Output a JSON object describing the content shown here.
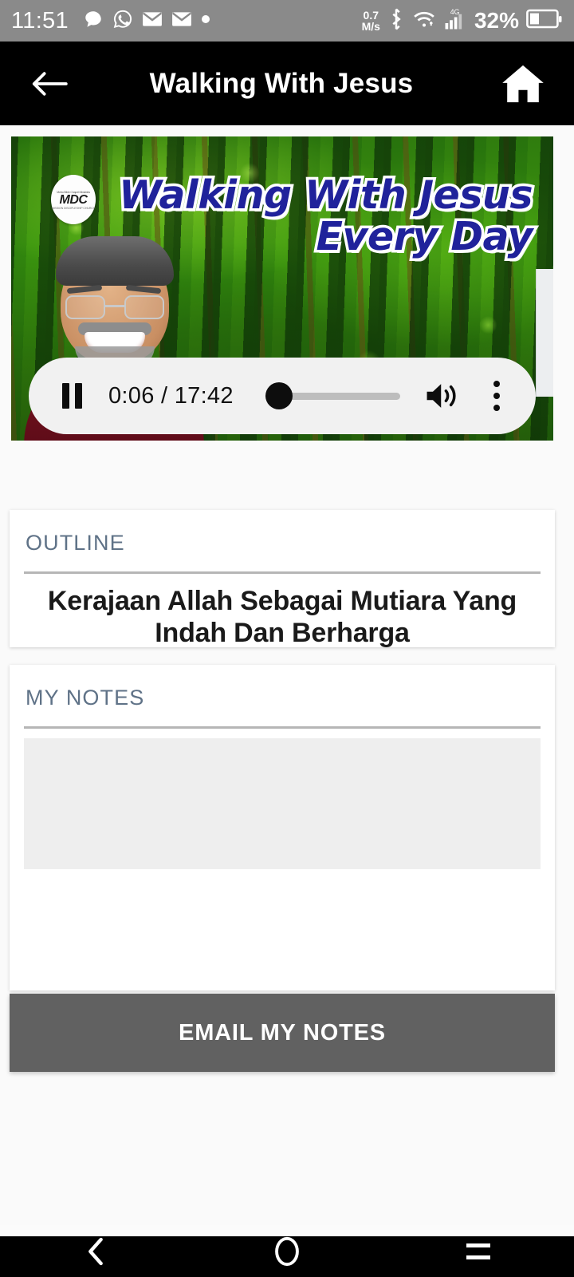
{
  "status_bar": {
    "time": "11:51",
    "left_icons": [
      "chat-bubble-icon",
      "whatsapp-icon",
      "mail-icon",
      "mail-icon",
      "dot-icon"
    ],
    "network_speed": "0.7",
    "network_speed_unit": "M/s",
    "bluetooth_icon": "bluetooth-icon",
    "wifi_icon": "wifi-icon",
    "cellular_label": "4G",
    "battery_percent": "32%",
    "background_color": "#8a8a8a"
  },
  "app_bar": {
    "title": "Walking With Jesus",
    "back_icon": "back-arrow-icon",
    "home_icon": "home-icon",
    "background_color": "#000000"
  },
  "video": {
    "overlay_title_line1": "Walking With Jesus",
    "overlay_title_line2": "Every Day",
    "overlay_title_color": "#20229b",
    "logo_top": "Metro Bible Chapel Ministries",
    "logo_text": "MDC",
    "logo_bottom": "MISSION DISCIPLESHIP CHURCH",
    "player": {
      "pause_icon": "pause-icon",
      "current_time": "0:06",
      "separator": "/",
      "duration": "17:42",
      "time_display": "0:06 / 17:42",
      "progress_percent": 0.6,
      "volume_icon": "volume-high-icon",
      "more_icon": "more-vertical-icon"
    }
  },
  "outline_card": {
    "label": "OUTLINE",
    "title": "Kerajaan Allah Sebagai Mutiara Yang Indah Dan Berharga",
    "label_color": "#5f7287"
  },
  "notes_card": {
    "label": "MY NOTES",
    "value": "",
    "placeholder": "",
    "label_color": "#5f7287"
  },
  "email_button": {
    "label": "EMAIL MY NOTES",
    "background_color": "#616161",
    "text_color": "#ffffff"
  },
  "nav_bar": {
    "back_icon": "nav-back-icon",
    "home_icon": "nav-home-circle-icon",
    "recents_icon": "nav-recents-icon",
    "background_color": "#000000"
  }
}
